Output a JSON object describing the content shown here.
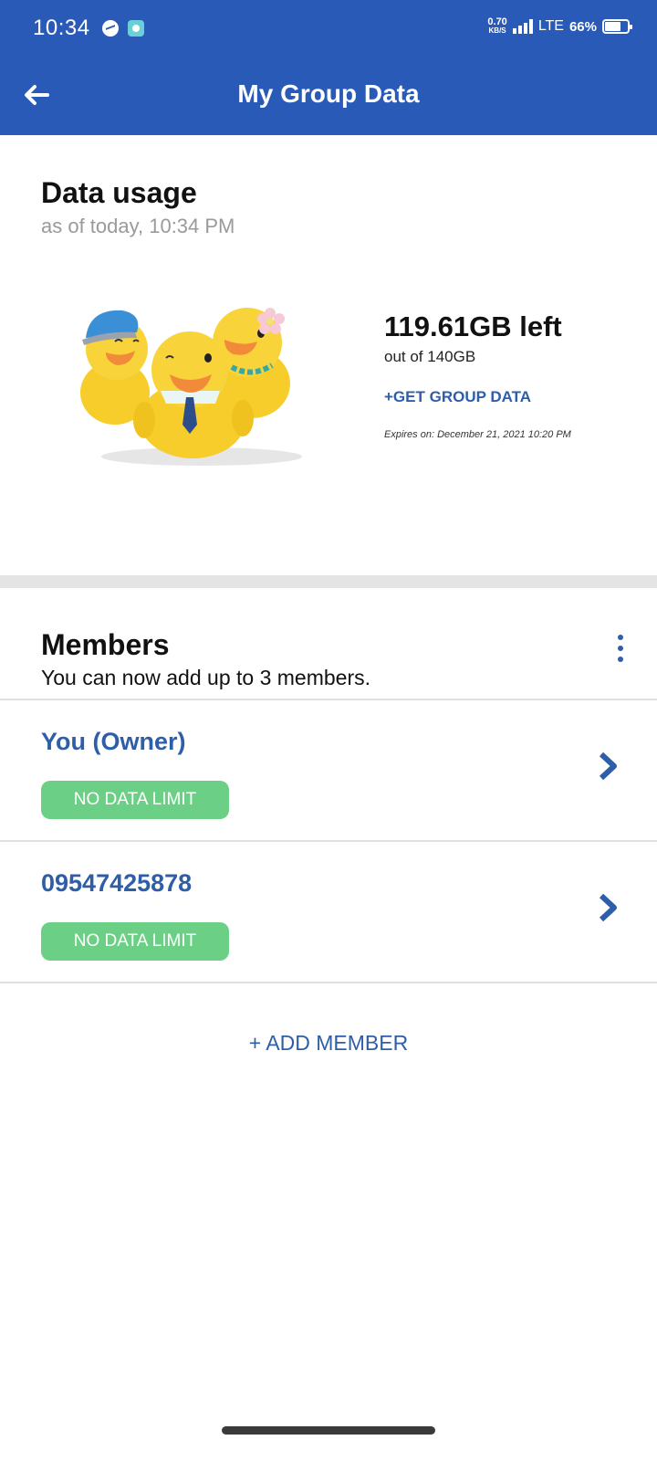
{
  "status_bar": {
    "time": "10:34",
    "speed_value": "0.70",
    "speed_unit": "KB/S",
    "network": "LTE",
    "battery": "66%"
  },
  "app_bar": {
    "title": "My Group Data",
    "back_icon": "arrow-left-icon"
  },
  "usage": {
    "title": "Data usage",
    "subtitle": "as of today, 10:34 PM",
    "left_label": "119.61GB left",
    "total_label": "out of 140GB",
    "get_data_label": "+GET GROUP DATA",
    "expires_label": "Expires on: December 21, 2021 10:20 PM",
    "illustration": "three-yellow-ducks-illustration",
    "remaining_fraction": 0.854
  },
  "members": {
    "title": "Members",
    "subtitle": "You can now add up to 3 members.",
    "menu_icon": "more-vertical-icon",
    "list": [
      {
        "name": "You (Owner)",
        "limit": "NO DATA LIMIT"
      },
      {
        "name": "09547425878",
        "limit": "NO DATA LIMIT"
      }
    ],
    "add_label": "+ ADD MEMBER"
  },
  "colors": {
    "brand_blue": "#2a5ab7",
    "link_blue": "#2f5ea8",
    "badge_green": "#6ccf86"
  }
}
